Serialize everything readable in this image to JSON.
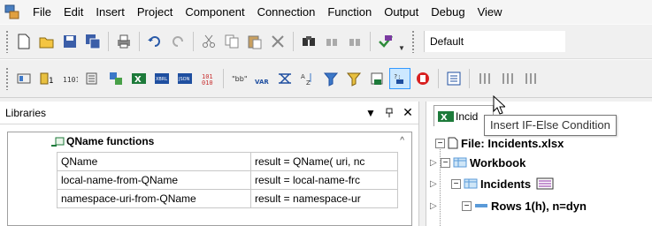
{
  "menu": {
    "items": [
      "File",
      "Edit",
      "Insert",
      "Project",
      "Component",
      "Connection",
      "Function",
      "Output",
      "Debug",
      "View"
    ]
  },
  "toolbar1": {
    "icons": [
      "new-file-icon",
      "open-folder-icon",
      "save-icon",
      "save-all-icon",
      "print-icon",
      "undo-icon",
      "redo-icon",
      "cut-icon",
      "copy-icon",
      "paste-icon",
      "delete-icon",
      "find-icon",
      "find-next-icon",
      "find-previous-icon",
      "validate-icon"
    ],
    "combo_value": "Default"
  },
  "toolbar2": {
    "icons": [
      "insert-input-icon",
      "insert-constant-icon",
      "insert-variable-icon",
      "insert-join-icon",
      "insert-sort-icon",
      "insert-excel-icon",
      "insert-xbrl-icon",
      "insert-json-icon",
      "insert-binary-icon",
      "insert-value-map-icon",
      "insert-var-icon",
      "insert-filter-icon",
      "insert-sort-az-icon",
      "insert-conditional-icon",
      "insert-sql-where-icon",
      "insert-if-else-icon",
      "insert-exception-icon",
      "insert-split-icon",
      "align-left-icon",
      "align-center-icon",
      "align-right-icon"
    ]
  },
  "libraries": {
    "title": "Libraries",
    "group": "QName functions",
    "rows": [
      {
        "name": "QName",
        "def": "result = QName( uri, nc"
      },
      {
        "name": "local-name-from-QName",
        "def": "result = local-name-frc"
      },
      {
        "name": "namespace-uri-from-QName",
        "def": "result = namespace-ur"
      }
    ]
  },
  "tree": {
    "tab_label": "Incid",
    "file_label": "File: Incidents.xlsx",
    "workbook_label": "Workbook",
    "sheet_label": "Incidents",
    "rows_label": "Rows 1(h), n=dyn"
  },
  "tooltip": "Insert IF-Else Condition",
  "colors": {
    "active_button_border": "#3399ff",
    "active_button_fill": "#cce8ff",
    "excel_green": "#1d7a3a"
  }
}
